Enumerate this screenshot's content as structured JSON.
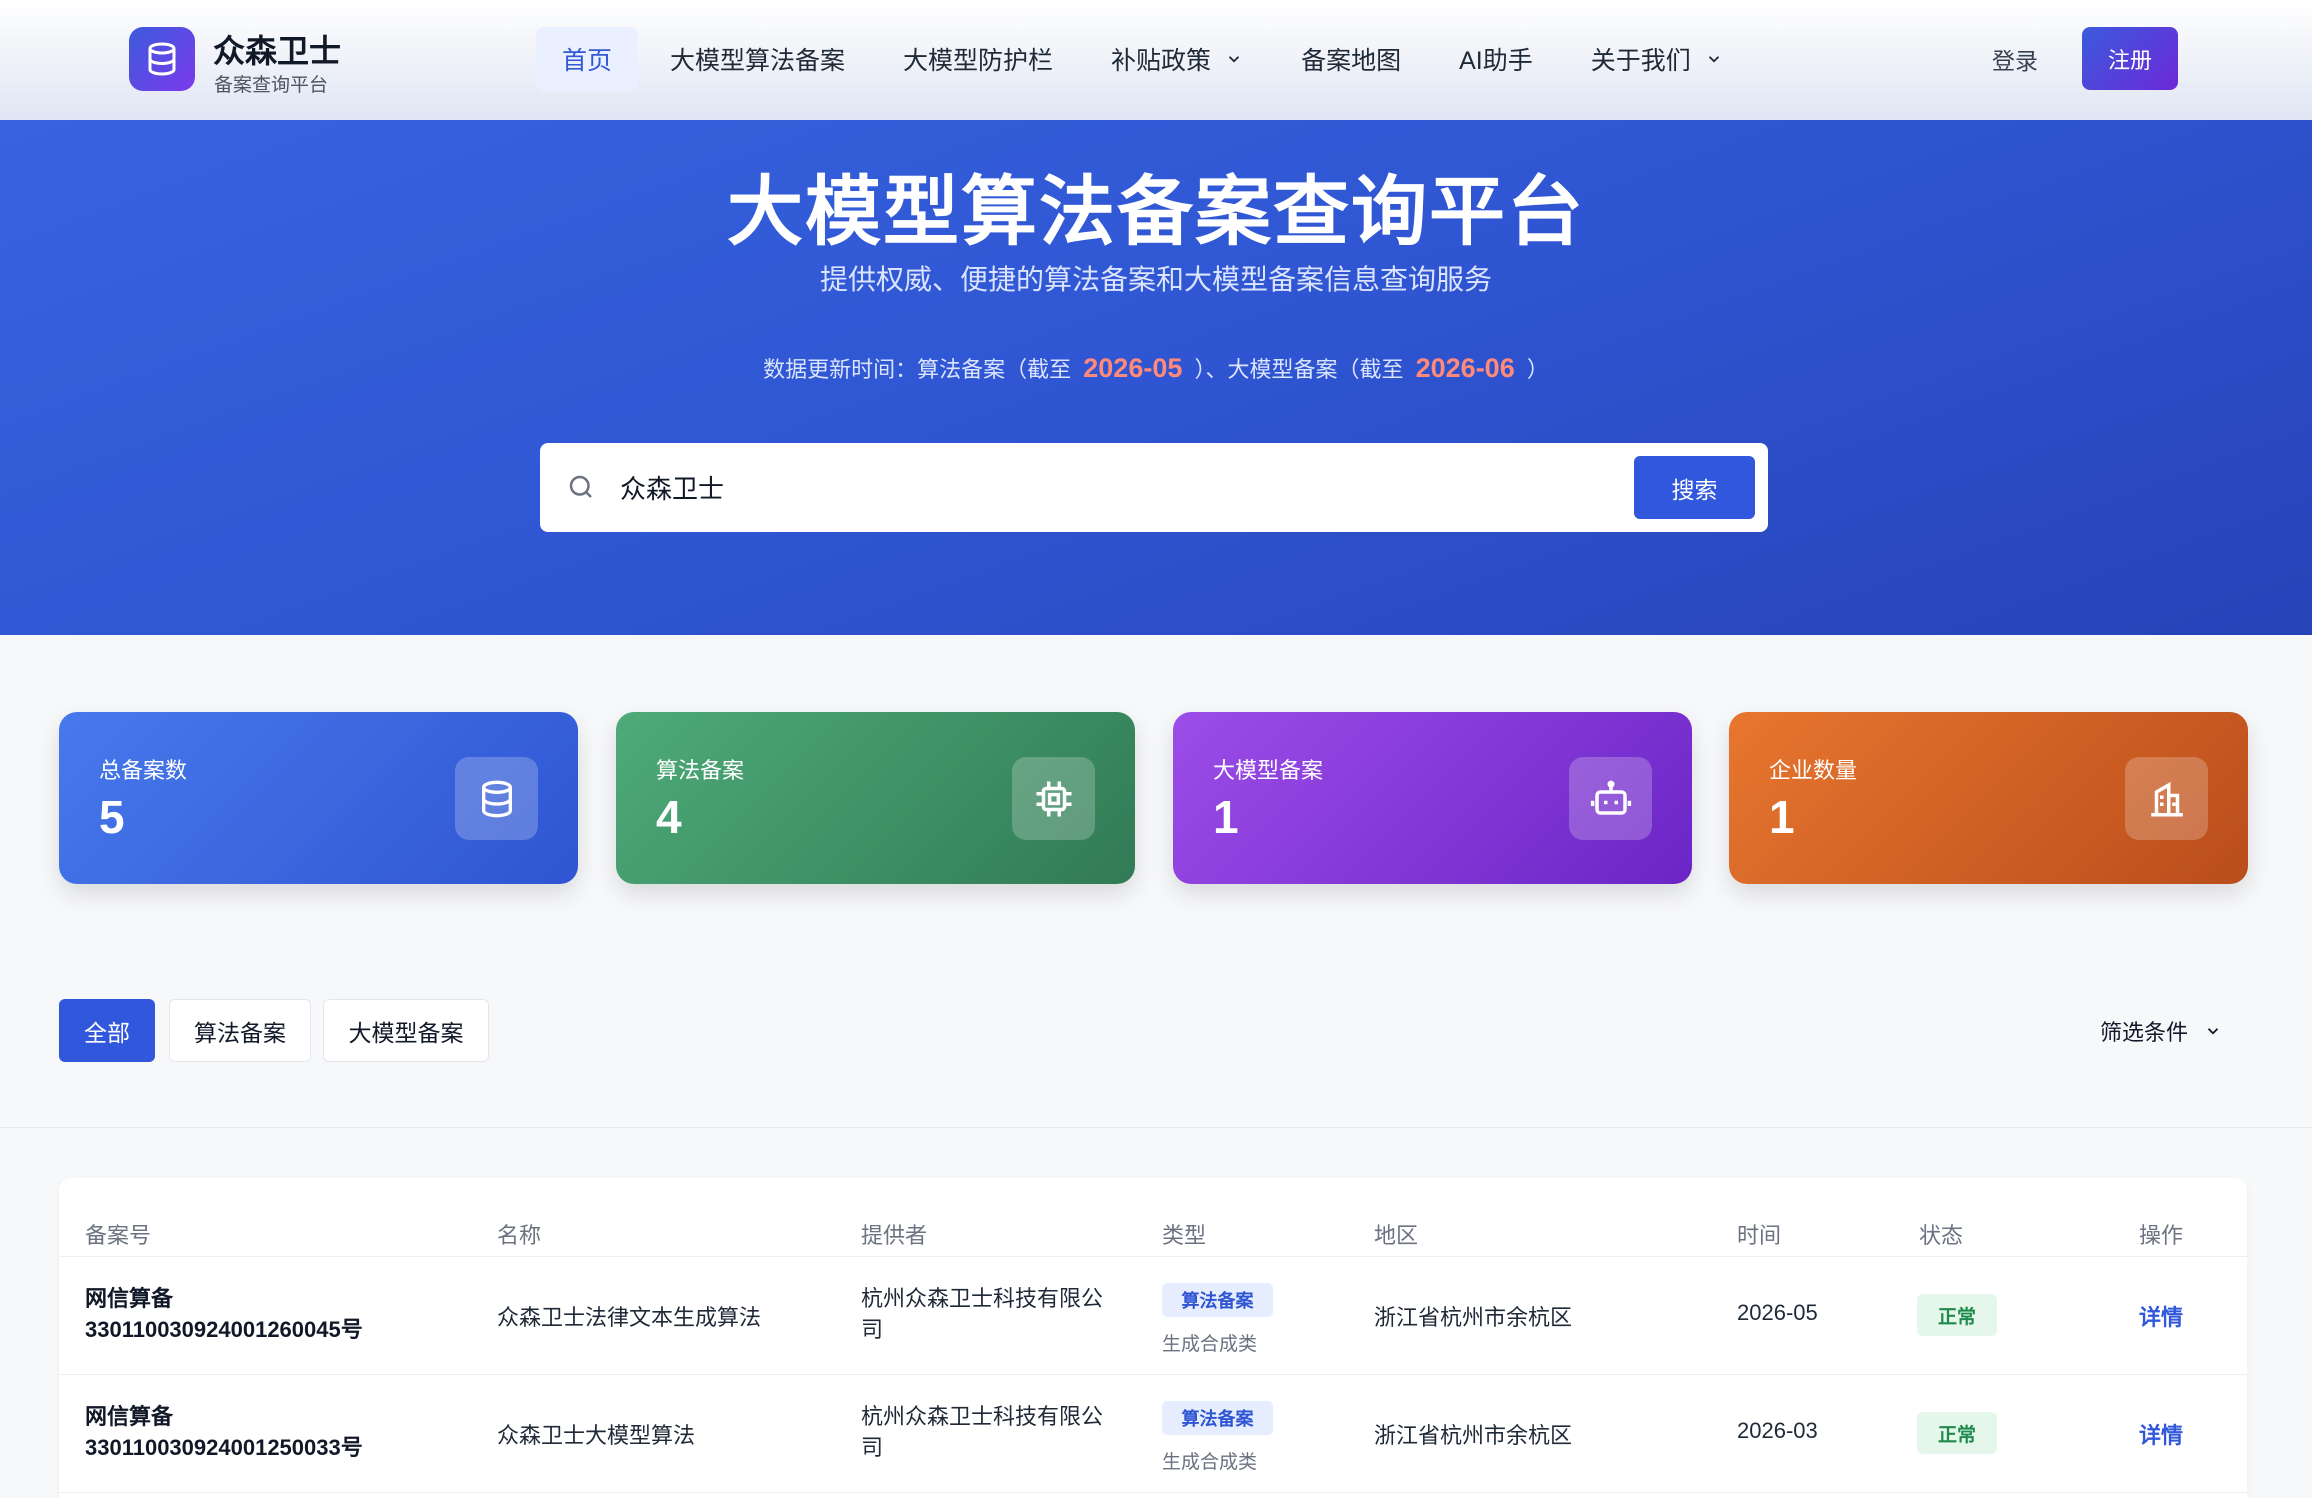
{
  "brand": {
    "name": "众森卫士",
    "subtitle": "备案查询平台",
    "logo_icon": "database-icon"
  },
  "nav": {
    "items": [
      {
        "label": "首页",
        "active": true
      },
      {
        "label": "大模型算法备案"
      },
      {
        "label": "大模型防护栏"
      },
      {
        "label": "补贴政策",
        "dropdown": true
      },
      {
        "label": "备案地图"
      },
      {
        "label": "AI助手"
      },
      {
        "label": "关于我们",
        "dropdown": true
      }
    ],
    "login": "登录",
    "register": "注册"
  },
  "hero": {
    "title": "大模型算法备案查询平台",
    "subtitle": "提供权威、便捷的算法备案和大模型备案信息查询服务",
    "update_prefix": "数据更新时间：算法备案（截至",
    "algo_date": "2026-05",
    "update_mid": "）、大模型备案（截至",
    "llm_date": "2026-06",
    "update_suffix": "）"
  },
  "search": {
    "value": "众森卫士",
    "button": "搜索"
  },
  "stats": [
    {
      "label": "总备案数",
      "value": "5",
      "icon": "database-icon",
      "color": "#3b63e0"
    },
    {
      "label": "算法备案",
      "value": "4",
      "icon": "chip-icon",
      "color": "#3f9a6a"
    },
    {
      "label": "大模型备案",
      "value": "1",
      "icon": "robot-icon",
      "color": "#8a3fe0"
    },
    {
      "label": "企业数量",
      "value": "1",
      "icon": "building-icon",
      "color": "#d7652a"
    }
  ],
  "filters": {
    "tabs": [
      "全部",
      "算法备案",
      "大模型备案"
    ],
    "active": "全部",
    "conditions": "筛选条件"
  },
  "table": {
    "headers": [
      "备案号",
      "名称",
      "提供者",
      "类型",
      "地区",
      "时间",
      "状态",
      "操作"
    ],
    "rows": [
      {
        "id_line1": "网信算备",
        "id_line2": "330110030924001260045号",
        "name": "众森卫士法律文本生成算法",
        "provider_line1": "杭州众森卫士科技有限公",
        "provider_line2": "司",
        "type": "算法备案",
        "type_sub": "生成合成类",
        "region": "浙江省杭州市余杭区",
        "time": "2026-05",
        "status": "正常",
        "action": "详情"
      },
      {
        "id_line1": "网信算备",
        "id_line2": "330110030924001250033号",
        "name": "众森卫士大模型算法",
        "provider_line1": "杭州众森卫士科技有限公",
        "provider_line2": "司",
        "type": "算法备案",
        "type_sub": "生成合成类",
        "region": "浙江省杭州市余杭区",
        "time": "2026-03",
        "status": "正常",
        "action": "详情"
      }
    ]
  }
}
